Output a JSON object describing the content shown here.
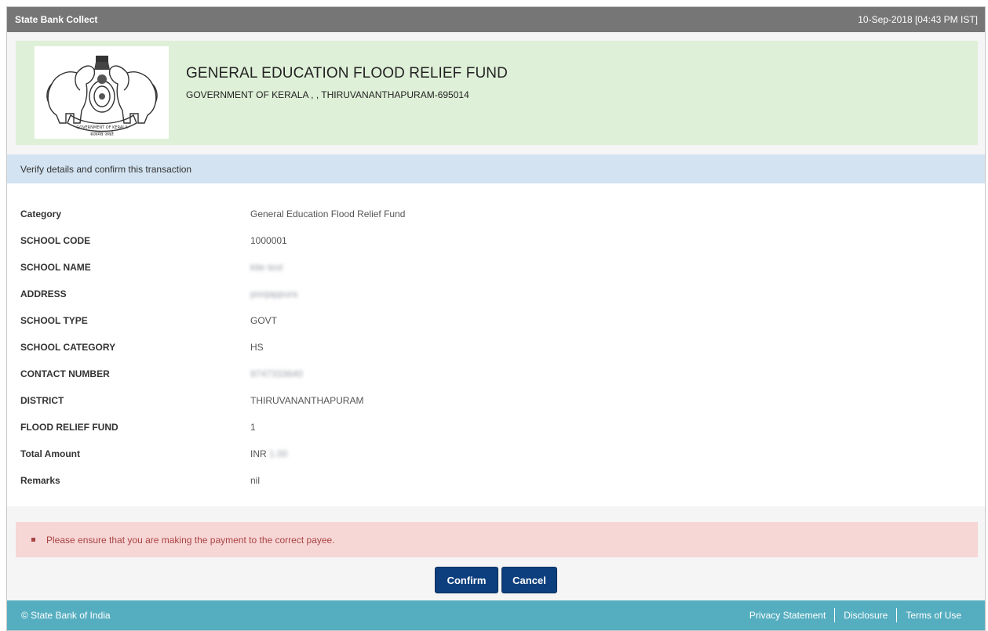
{
  "header": {
    "app_title": "State Bank Collect",
    "datetime": "10-Sep-2018 [04:43 PM IST]"
  },
  "banner": {
    "emblem_icon": "kerala-state-emblem-icon",
    "title": "GENERAL EDUCATION FLOOD RELIEF FUND",
    "subtitle": "GOVERNMENT OF KERALA , , THIRUVANANTHAPURAM-695014"
  },
  "info": {
    "message": "Verify details and confirm this transaction"
  },
  "details": [
    {
      "label": "Category",
      "value": "General Education Flood Relief Fund",
      "blurred": false
    },
    {
      "label": "SCHOOL CODE",
      "value": "1000001",
      "blurred": false
    },
    {
      "label": "SCHOOL NAME",
      "value": "kite test",
      "blurred": true
    },
    {
      "label": "ADDRESS",
      "value": "poojappura",
      "blurred": true
    },
    {
      "label": "SCHOOL TYPE",
      "value": "GOVT",
      "blurred": false
    },
    {
      "label": "SCHOOL CATEGORY",
      "value": "HS",
      "blurred": false
    },
    {
      "label": "CONTACT NUMBER",
      "value": "9747333640",
      "blurred": true
    },
    {
      "label": "DISTRICT",
      "value": "THIRUVANANTHAPURAM",
      "blurred": false
    },
    {
      "label": "FLOOD RELIEF FUND",
      "value": "1",
      "blurred": false
    },
    {
      "label": "Total Amount",
      "value_prefix": "INR ",
      "value": "1.00",
      "blurred": true
    },
    {
      "label": "Remarks",
      "value": "nil",
      "blurred": false
    }
  ],
  "warning": {
    "message": "Please ensure that you are making the payment to the correct payee."
  },
  "actions": {
    "confirm_label": "Confirm",
    "cancel_label": "Cancel"
  },
  "footer": {
    "copyright": "© State Bank of India",
    "links": [
      "Privacy Statement",
      "Disclosure",
      "Terms of Use"
    ]
  },
  "colors": {
    "header_bg": "#767676",
    "banner_bg": "#dff0d8",
    "info_bg": "#d3e3f1",
    "warning_bg": "#f7d6d6",
    "button_bg": "#0d3f7e",
    "footer_bg": "#55aec0"
  }
}
